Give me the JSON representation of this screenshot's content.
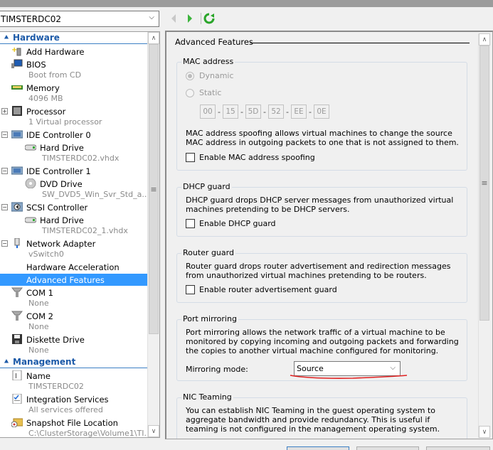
{
  "toolbar": {
    "vm_name": "TIMSTERDC02",
    "back_icon": "back-arrow-icon",
    "forward_icon": "forward-arrow-icon",
    "refresh_icon": "refresh-icon"
  },
  "sidebar": {
    "hardware_header": "Hardware",
    "management_header": "Management",
    "items": [
      {
        "label": "Add Hardware",
        "sub": "",
        "icon": "add-hardware-icon"
      },
      {
        "label": "BIOS",
        "sub": "Boot from CD",
        "icon": "bios-icon"
      },
      {
        "label": "Memory",
        "sub": "4096 MB",
        "icon": "memory-icon"
      },
      {
        "label": "Processor",
        "sub": "1 Virtual processor",
        "icon": "processor-icon",
        "expander": "+"
      },
      {
        "label": "IDE Controller 0",
        "sub": "",
        "icon": "ide-controller-icon",
        "expander": "−"
      },
      {
        "label": "Hard Drive",
        "sub": "TIMSTERDC02.vhdx",
        "icon": "hard-drive-icon"
      },
      {
        "label": "IDE Controller 1",
        "sub": "",
        "icon": "ide-controller-icon",
        "expander": "−"
      },
      {
        "label": "DVD Drive",
        "sub": "SW_DVD5_Win_Svr_Std_a...",
        "icon": "dvd-drive-icon"
      },
      {
        "label": "SCSI Controller",
        "sub": "",
        "icon": "scsi-controller-icon",
        "expander": "−"
      },
      {
        "label": "Hard Drive",
        "sub": "TIMSTERDC02_1.vhdx",
        "icon": "hard-drive-icon"
      },
      {
        "label": "Network Adapter",
        "sub": "vSwitch0",
        "icon": "network-adapter-icon",
        "expander": "−"
      },
      {
        "label": "Hardware Acceleration",
        "sub": ""
      },
      {
        "label": "Advanced Features",
        "sub": "",
        "selected": true
      },
      {
        "label": "COM 1",
        "sub": "None",
        "icon": "com-port-icon"
      },
      {
        "label": "COM 2",
        "sub": "None",
        "icon": "com-port-icon"
      },
      {
        "label": "Diskette Drive",
        "sub": "None",
        "icon": "diskette-icon"
      }
    ],
    "management_items": [
      {
        "label": "Name",
        "sub": "TIMSTERDC02",
        "icon": "name-icon"
      },
      {
        "label": "Integration Services",
        "sub": "All services offered",
        "icon": "integration-services-icon"
      },
      {
        "label": "Snapshot File Location",
        "sub": "C:\\ClusterStorage\\Volume1\\TI...",
        "icon": "snapshot-folder-icon"
      }
    ]
  },
  "main": {
    "title": "Advanced Features",
    "mac": {
      "legend": "MAC address",
      "dynamic_label": "Dynamic",
      "static_label": "Static",
      "selected": "Dynamic",
      "octets": [
        "00",
        "15",
        "5D",
        "52",
        "EE",
        "0E"
      ],
      "description": "MAC address spoofing allows virtual machines to change the source MAC address in outgoing packets to one that is not assigned to them.",
      "spoofing_label": "Enable MAC address spoofing",
      "spoofing_checked": false
    },
    "dhcp": {
      "legend": "DHCP guard",
      "description": "DHCP guard drops DHCP server messages from unauthorized virtual machines pretending to be DHCP servers.",
      "checkbox_label": "Enable DHCP guard",
      "checked": false
    },
    "router": {
      "legend": "Router guard",
      "description": "Router guard drops router advertisement and redirection messages from unauthorized virtual machines pretending to be routers.",
      "checkbox_label": "Enable router advertisement guard",
      "checked": false
    },
    "mirroring": {
      "legend": "Port mirroring",
      "description": "Port mirroring allows the network traffic of a virtual machine to be monitored by copying incoming and outgoing packets and forwarding the copies to another virtual machine configured for monitoring.",
      "mode_label": "Mirroring mode:",
      "mode_value": "Source",
      "annotation_color": "#e02020"
    },
    "teaming": {
      "legend": "NIC Teaming",
      "description": "You can establish NIC Teaming in the guest operating system to aggregate bandwidth and provide redundancy. This is useful if teaming is not configured in the management operating system."
    }
  },
  "colors": {
    "accent": "#3399ff",
    "section_header": "#1c5aa8"
  }
}
